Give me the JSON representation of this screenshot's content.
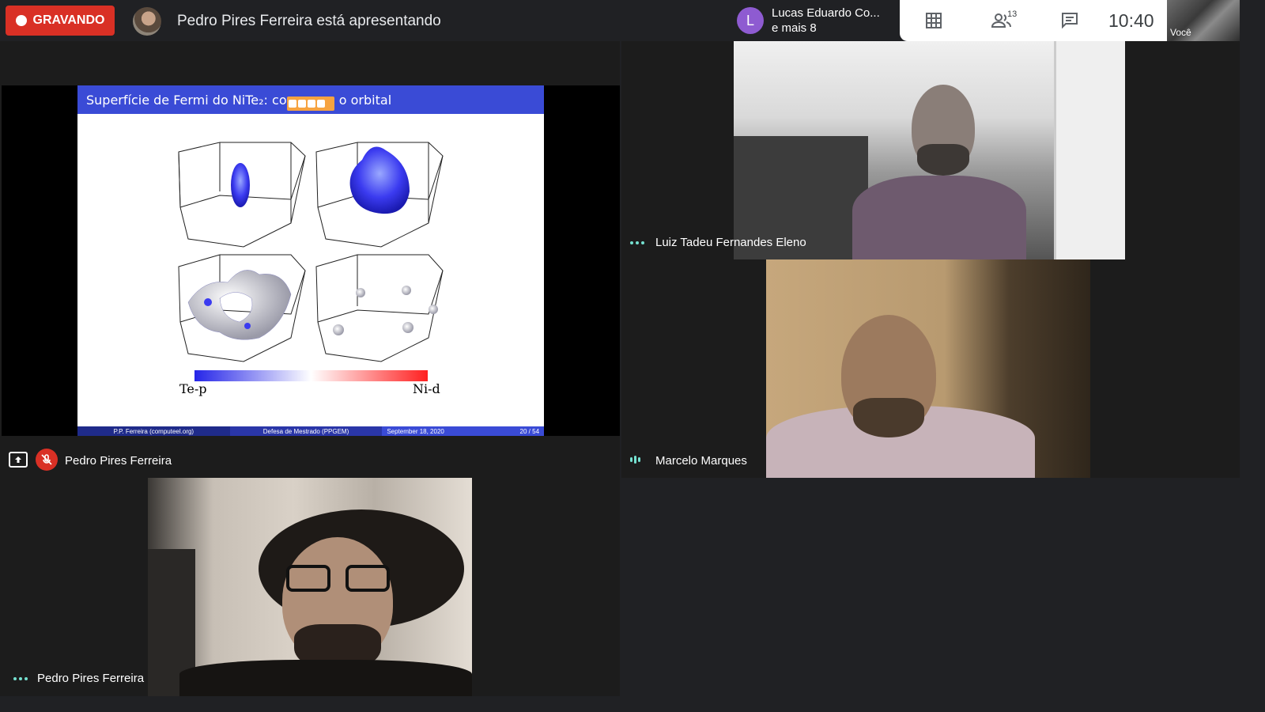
{
  "header": {
    "recording_label": "GRAVANDO",
    "presenting_text": "Pedro Pires Ferreira está apresentando"
  },
  "participants_chip": {
    "avatar_letter": "L",
    "line1": "Lucas Eduardo Co...",
    "line2": "e mais 8"
  },
  "toolbar": {
    "people_count": "13",
    "time": "10:40"
  },
  "self_view": {
    "label": "Você"
  },
  "slide": {
    "title": "Superfície de Fermi do NiTe₂: con",
    "title_end": "o orbital",
    "colorbar_left": "Te-p",
    "colorbar_right": "Ni-d",
    "footer_author": "P.P. Ferreira (computeel.org)",
    "footer_event": "Defesa de Mestrado (PPGEM)",
    "footer_date": "September 18, 2020",
    "footer_page": "20 / 54"
  },
  "tiles": {
    "presenter_name": "Pedro Pires Ferreira",
    "luiz_name": "Luiz Tadeu Fernandes Eleno",
    "marcelo_name": "Marcelo Marques",
    "pedro_name": "Pedro Pires Ferreira"
  },
  "colors": {
    "recording": "#d93025",
    "slide_header": "#3a4bd6",
    "audio_indicator": "#75e0d0",
    "avatar_l": "#8e5bd1"
  }
}
